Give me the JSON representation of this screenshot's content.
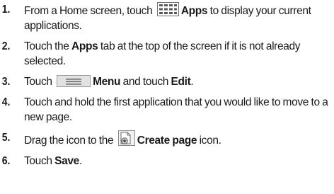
{
  "steps": [
    {
      "number": "1.",
      "pre": "From a Home screen, touch ",
      "icon": "apps-grid-icon",
      "bold": "Apps",
      "post": " to display your current applications."
    },
    {
      "number": "2.",
      "pre": "Touch the ",
      "bold": "Apps",
      "post": " tab at the top of the screen if it is not already selected."
    },
    {
      "number": "3.",
      "pre": "Touch ",
      "icon": "menu-icon",
      "bold": "Menu",
      "mid": " and touch ",
      "bold2": "Edit",
      "post": "."
    },
    {
      "number": "4.",
      "text": "Touch and hold the first application that you would like to move to a new page."
    },
    {
      "number": "5.",
      "pre": "Drag the icon to the ",
      "icon": "create-page-icon",
      "bold": "Create page",
      "post": " icon."
    },
    {
      "number": "6.",
      "pre": "Touch ",
      "bold": "Save",
      "post": "."
    }
  ],
  "colors": {
    "text": "#1a1a1a",
    "icon_fill": "#dcdcdc",
    "icon_stroke": "#707070"
  }
}
